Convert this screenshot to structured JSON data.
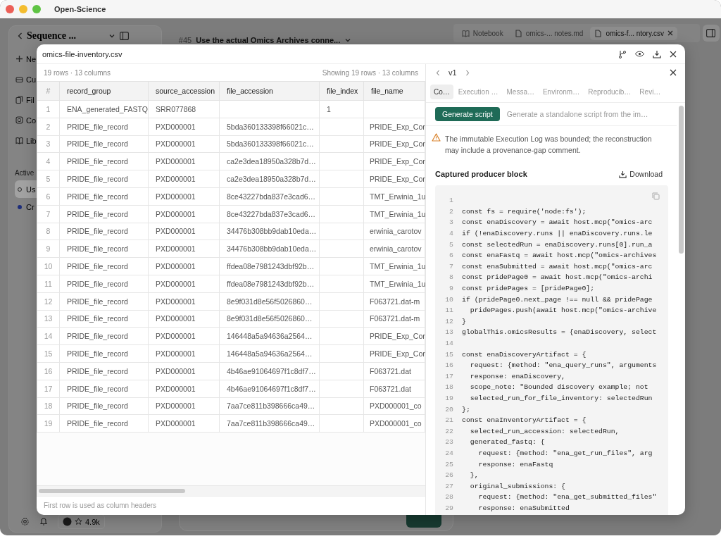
{
  "window": {
    "title": "Open-Science"
  },
  "sidebar": {
    "title": "Sequence ...",
    "items": [
      {
        "label": "Ne",
        "kind": "new"
      },
      {
        "label": "Cu",
        "kind": "box"
      },
      {
        "label": "Fil",
        "kind": "files"
      },
      {
        "label": "Co",
        "kind": "chip"
      },
      {
        "label": "Lib",
        "kind": "book"
      }
    ],
    "section": "Active",
    "sessions": [
      {
        "label": "Us",
        "kind": "idle",
        "selected": true
      },
      {
        "label": "Cr",
        "kind": "running",
        "selected": false
      }
    ],
    "star_count": "4.9k"
  },
  "thread": {
    "number": "#45",
    "title": "Use the actual Omics Archives conne..."
  },
  "doc_tabs": [
    {
      "label": "Notebook",
      "kind": "notebook",
      "selected": false
    },
    {
      "label": "omics-... notes.md",
      "kind": "file",
      "selected": false
    },
    {
      "label": "omics-f... ntory.csv",
      "kind": "file",
      "selected": true
    }
  ],
  "dialog": {
    "title": "omics-file-inventory.csv",
    "summary": "19 rows · 13 columns",
    "showing": "Showing 19 rows · 13 columns",
    "columns": [
      "#",
      "record_group",
      "source_accession",
      "file_accession",
      "file_index",
      "file_name"
    ],
    "rows": [
      [
        "1",
        "ENA_generated_FASTQ",
        "SRR077868",
        null,
        "1",
        null
      ],
      [
        "2",
        "PRIDE_file_record",
        "PXD000001",
        "5bda360133398f66021c…",
        null,
        "PRIDE_Exp_Cor"
      ],
      [
        "3",
        "PRIDE_file_record",
        "PXD000001",
        "5bda360133398f66021c…",
        null,
        "PRIDE_Exp_Cor"
      ],
      [
        "4",
        "PRIDE_file_record",
        "PXD000001",
        "ca2e3dea18950a328b7d…",
        null,
        "PRIDE_Exp_Cor"
      ],
      [
        "5",
        "PRIDE_file_record",
        "PXD000001",
        "ca2e3dea18950a328b7d…",
        null,
        "PRIDE_Exp_Cor"
      ],
      [
        "6",
        "PRIDE_file_record",
        "PXD000001",
        "8ce43227bda837e3cad6…",
        null,
        "TMT_Erwinia_1u"
      ],
      [
        "7",
        "PRIDE_file_record",
        "PXD000001",
        "8ce43227bda837e3cad6…",
        null,
        "TMT_Erwinia_1u"
      ],
      [
        "8",
        "PRIDE_file_record",
        "PXD000001",
        "34476b308bb9dab10eda…",
        null,
        "erwinia_carotov"
      ],
      [
        "9",
        "PRIDE_file_record",
        "PXD000001",
        "34476b308bb9dab10eda…",
        null,
        "erwinia_carotov"
      ],
      [
        "10",
        "PRIDE_file_record",
        "PXD000001",
        "ffdea08e7981243dbf92b…",
        null,
        "TMT_Erwinia_1u"
      ],
      [
        "11",
        "PRIDE_file_record",
        "PXD000001",
        "ffdea08e7981243dbf92b…",
        null,
        "TMT_Erwinia_1u"
      ],
      [
        "12",
        "PRIDE_file_record",
        "PXD000001",
        "8e9f031d8e56f5026860…",
        null,
        "F063721.dat-m"
      ],
      [
        "13",
        "PRIDE_file_record",
        "PXD000001",
        "8e9f031d8e56f5026860…",
        null,
        "F063721.dat-m"
      ],
      [
        "14",
        "PRIDE_file_record",
        "PXD000001",
        "146448a5a94636a2564…",
        null,
        "PRIDE_Exp_Cor"
      ],
      [
        "15",
        "PRIDE_file_record",
        "PXD000001",
        "146448a5a94636a2564…",
        null,
        "PRIDE_Exp_Cor"
      ],
      [
        "16",
        "PRIDE_file_record",
        "PXD000001",
        "4b46ae91064697f1c8df7…",
        null,
        "F063721.dat"
      ],
      [
        "17",
        "PRIDE_file_record",
        "PXD000001",
        "4b46ae91064697f1c8df7…",
        null,
        "F063721.dat"
      ],
      [
        "18",
        "PRIDE_file_record",
        "PXD000001",
        "7aa7ce811b398666ca49…",
        null,
        "PXD000001_co"
      ],
      [
        "19",
        "PRIDE_file_record",
        "PXD000001",
        "7aa7ce811b398666ca49…",
        null,
        "PXD000001_co"
      ]
    ],
    "footer": "First row is used as column headers",
    "inspector": {
      "version": "v1",
      "tabs": [
        {
          "label": "Co…",
          "selected": true
        },
        {
          "label": "Execution …",
          "selected": false
        },
        {
          "label": "Messa…",
          "selected": false
        },
        {
          "label": "Environm…",
          "selected": false
        },
        {
          "label": "Reproducib…",
          "selected": false
        },
        {
          "label": "Revi…",
          "selected": false
        }
      ],
      "action_button": "Generate script",
      "action_hint": "Generate a standalone script from the im…",
      "warning": "The immutable Execution Log was bounded; the reconstruction may include a provenance-gap comment.",
      "section_title": "Captured producer block",
      "download": "Download",
      "code": [
        {
          "n": "1"
        },
        {
          "n": "2",
          "text": "const fs = require('node:fs');"
        },
        {
          "n": "3",
          "text": "const enaDiscovery = await host.mcp(\"omics-arc"
        },
        {
          "n": "4",
          "text": "if (!enaDiscovery.runs || enaDiscovery.runs.le"
        },
        {
          "n": "5",
          "text": "const selectedRun = enaDiscovery.runs[0].run_a"
        },
        {
          "n": "6",
          "text": "const enaFastq = await host.mcp(\"omics-archives"
        },
        {
          "n": "7",
          "text": "const enaSubmitted = await host.mcp(\"omics-arc"
        },
        {
          "n": "8",
          "text": "const pridePage0 = await host.mcp(\"omics-archi"
        },
        {
          "n": "9",
          "text": "const pridePages = [pridePage0];"
        },
        {
          "n": "10",
          "text": "if (pridePage0.next_page !== null && pridePage"
        },
        {
          "n": "11",
          "text": "  pridePages.push(await host.mcp(\"omics-archive"
        },
        {
          "n": "12",
          "text": "}"
        },
        {
          "n": "13",
          "text": "globalThis.omicsResults = {enaDiscovery, select"
        },
        {
          "n": "14"
        },
        {
          "n": "15",
          "text": "const enaDiscoveryArtifact = {"
        },
        {
          "n": "16",
          "text": "  request: {method: \"ena_query_runs\", arguments"
        },
        {
          "n": "17",
          "text": "  response: enaDiscovery,"
        },
        {
          "n": "18",
          "text": "  scope_note: \"Bounded discovery example; not"
        },
        {
          "n": "19",
          "text": "  selected_run_for_file_inventory: selectedRun"
        },
        {
          "n": "20",
          "text": "};"
        },
        {
          "n": "21",
          "text": "const enaInventoryArtifact = {"
        },
        {
          "n": "22",
          "text": "  selected_run_accession: selectedRun,"
        },
        {
          "n": "23",
          "text": "  generated_fastq: {"
        },
        {
          "n": "24",
          "text": "    request: {method: \"ena_get_run_files\", arg"
        },
        {
          "n": "25",
          "text": "    response: enaFastq"
        },
        {
          "n": "26",
          "text": "  },"
        },
        {
          "n": "27",
          "text": "  original_submissions: {"
        },
        {
          "n": "28",
          "text": "    request: {method: \"ena_get_submitted_files\""
        },
        {
          "n": "29",
          "text": "    response: enaSubmitted"
        }
      ]
    }
  }
}
